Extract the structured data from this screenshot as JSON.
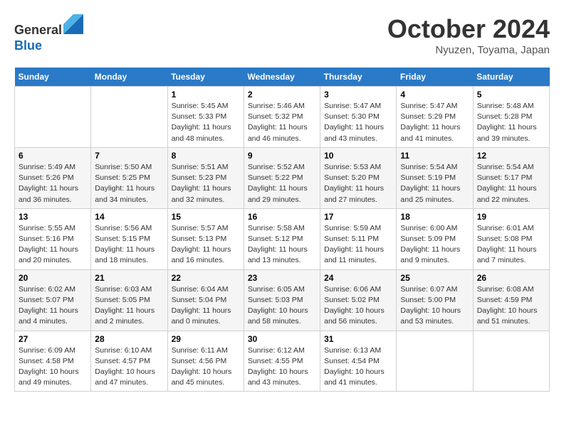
{
  "header": {
    "logo_line1": "General",
    "logo_line2": "Blue",
    "month_title": "October 2024",
    "location": "Nyuzen, Toyama, Japan"
  },
  "weekdays": [
    "Sunday",
    "Monday",
    "Tuesday",
    "Wednesday",
    "Thursday",
    "Friday",
    "Saturday"
  ],
  "weeks": [
    [
      {
        "day": "",
        "sunrise": "",
        "sunset": "",
        "daylight": ""
      },
      {
        "day": "",
        "sunrise": "",
        "sunset": "",
        "daylight": ""
      },
      {
        "day": "1",
        "sunrise": "Sunrise: 5:45 AM",
        "sunset": "Sunset: 5:33 PM",
        "daylight": "Daylight: 11 hours and 48 minutes."
      },
      {
        "day": "2",
        "sunrise": "Sunrise: 5:46 AM",
        "sunset": "Sunset: 5:32 PM",
        "daylight": "Daylight: 11 hours and 46 minutes."
      },
      {
        "day": "3",
        "sunrise": "Sunrise: 5:47 AM",
        "sunset": "Sunset: 5:30 PM",
        "daylight": "Daylight: 11 hours and 43 minutes."
      },
      {
        "day": "4",
        "sunrise": "Sunrise: 5:47 AM",
        "sunset": "Sunset: 5:29 PM",
        "daylight": "Daylight: 11 hours and 41 minutes."
      },
      {
        "day": "5",
        "sunrise": "Sunrise: 5:48 AM",
        "sunset": "Sunset: 5:28 PM",
        "daylight": "Daylight: 11 hours and 39 minutes."
      }
    ],
    [
      {
        "day": "6",
        "sunrise": "Sunrise: 5:49 AM",
        "sunset": "Sunset: 5:26 PM",
        "daylight": "Daylight: 11 hours and 36 minutes."
      },
      {
        "day": "7",
        "sunrise": "Sunrise: 5:50 AM",
        "sunset": "Sunset: 5:25 PM",
        "daylight": "Daylight: 11 hours and 34 minutes."
      },
      {
        "day": "8",
        "sunrise": "Sunrise: 5:51 AM",
        "sunset": "Sunset: 5:23 PM",
        "daylight": "Daylight: 11 hours and 32 minutes."
      },
      {
        "day": "9",
        "sunrise": "Sunrise: 5:52 AM",
        "sunset": "Sunset: 5:22 PM",
        "daylight": "Daylight: 11 hours and 29 minutes."
      },
      {
        "day": "10",
        "sunrise": "Sunrise: 5:53 AM",
        "sunset": "Sunset: 5:20 PM",
        "daylight": "Daylight: 11 hours and 27 minutes."
      },
      {
        "day": "11",
        "sunrise": "Sunrise: 5:54 AM",
        "sunset": "Sunset: 5:19 PM",
        "daylight": "Daylight: 11 hours and 25 minutes."
      },
      {
        "day": "12",
        "sunrise": "Sunrise: 5:54 AM",
        "sunset": "Sunset: 5:17 PM",
        "daylight": "Daylight: 11 hours and 22 minutes."
      }
    ],
    [
      {
        "day": "13",
        "sunrise": "Sunrise: 5:55 AM",
        "sunset": "Sunset: 5:16 PM",
        "daylight": "Daylight: 11 hours and 20 minutes."
      },
      {
        "day": "14",
        "sunrise": "Sunrise: 5:56 AM",
        "sunset": "Sunset: 5:15 PM",
        "daylight": "Daylight: 11 hours and 18 minutes."
      },
      {
        "day": "15",
        "sunrise": "Sunrise: 5:57 AM",
        "sunset": "Sunset: 5:13 PM",
        "daylight": "Daylight: 11 hours and 16 minutes."
      },
      {
        "day": "16",
        "sunrise": "Sunrise: 5:58 AM",
        "sunset": "Sunset: 5:12 PM",
        "daylight": "Daylight: 11 hours and 13 minutes."
      },
      {
        "day": "17",
        "sunrise": "Sunrise: 5:59 AM",
        "sunset": "Sunset: 5:11 PM",
        "daylight": "Daylight: 11 hours and 11 minutes."
      },
      {
        "day": "18",
        "sunrise": "Sunrise: 6:00 AM",
        "sunset": "Sunset: 5:09 PM",
        "daylight": "Daylight: 11 hours and 9 minutes."
      },
      {
        "day": "19",
        "sunrise": "Sunrise: 6:01 AM",
        "sunset": "Sunset: 5:08 PM",
        "daylight": "Daylight: 11 hours and 7 minutes."
      }
    ],
    [
      {
        "day": "20",
        "sunrise": "Sunrise: 6:02 AM",
        "sunset": "Sunset: 5:07 PM",
        "daylight": "Daylight: 11 hours and 4 minutes."
      },
      {
        "day": "21",
        "sunrise": "Sunrise: 6:03 AM",
        "sunset": "Sunset: 5:05 PM",
        "daylight": "Daylight: 11 hours and 2 minutes."
      },
      {
        "day": "22",
        "sunrise": "Sunrise: 6:04 AM",
        "sunset": "Sunset: 5:04 PM",
        "daylight": "Daylight: 11 hours and 0 minutes."
      },
      {
        "day": "23",
        "sunrise": "Sunrise: 6:05 AM",
        "sunset": "Sunset: 5:03 PM",
        "daylight": "Daylight: 10 hours and 58 minutes."
      },
      {
        "day": "24",
        "sunrise": "Sunrise: 6:06 AM",
        "sunset": "Sunset: 5:02 PM",
        "daylight": "Daylight: 10 hours and 56 minutes."
      },
      {
        "day": "25",
        "sunrise": "Sunrise: 6:07 AM",
        "sunset": "Sunset: 5:00 PM",
        "daylight": "Daylight: 10 hours and 53 minutes."
      },
      {
        "day": "26",
        "sunrise": "Sunrise: 6:08 AM",
        "sunset": "Sunset: 4:59 PM",
        "daylight": "Daylight: 10 hours and 51 minutes."
      }
    ],
    [
      {
        "day": "27",
        "sunrise": "Sunrise: 6:09 AM",
        "sunset": "Sunset: 4:58 PM",
        "daylight": "Daylight: 10 hours and 49 minutes."
      },
      {
        "day": "28",
        "sunrise": "Sunrise: 6:10 AM",
        "sunset": "Sunset: 4:57 PM",
        "daylight": "Daylight: 10 hours and 47 minutes."
      },
      {
        "day": "29",
        "sunrise": "Sunrise: 6:11 AM",
        "sunset": "Sunset: 4:56 PM",
        "daylight": "Daylight: 10 hours and 45 minutes."
      },
      {
        "day": "30",
        "sunrise": "Sunrise: 6:12 AM",
        "sunset": "Sunset: 4:55 PM",
        "daylight": "Daylight: 10 hours and 43 minutes."
      },
      {
        "day": "31",
        "sunrise": "Sunrise: 6:13 AM",
        "sunset": "Sunset: 4:54 PM",
        "daylight": "Daylight: 10 hours and 41 minutes."
      },
      {
        "day": "",
        "sunrise": "",
        "sunset": "",
        "daylight": ""
      },
      {
        "day": "",
        "sunrise": "",
        "sunset": "",
        "daylight": ""
      }
    ]
  ]
}
